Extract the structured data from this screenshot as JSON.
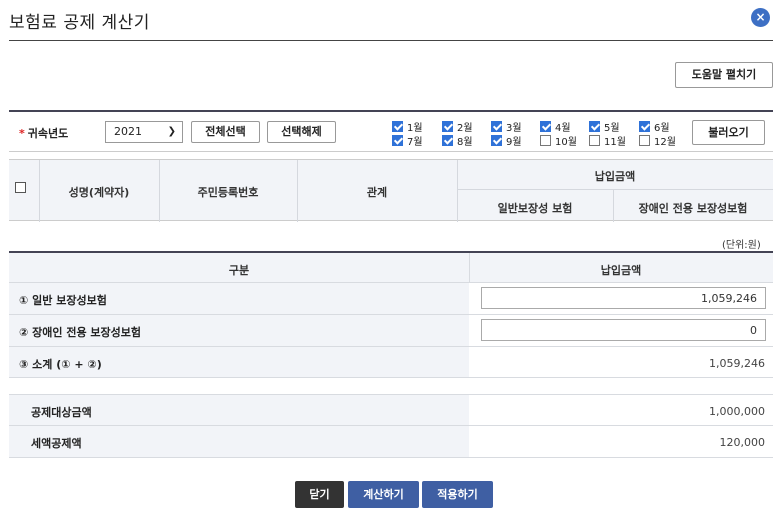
{
  "header": {
    "title": "보험료 공제 계산기",
    "close_icon": "×"
  },
  "toolbar": {
    "help_label": "도움말 펼치기"
  },
  "filter": {
    "year_label": "귀속년도",
    "year_value": "2021",
    "select_all_label": "전체선택",
    "deselect_label": "선택해제",
    "load_label": "불러오기",
    "months": [
      {
        "label": "1월",
        "checked": true
      },
      {
        "label": "2월",
        "checked": true
      },
      {
        "label": "3월",
        "checked": true
      },
      {
        "label": "4월",
        "checked": true
      },
      {
        "label": "5월",
        "checked": true
      },
      {
        "label": "6월",
        "checked": true
      },
      {
        "label": "7월",
        "checked": true
      },
      {
        "label": "8월",
        "checked": true
      },
      {
        "label": "9월",
        "checked": true
      },
      {
        "label": "10월",
        "checked": false
      },
      {
        "label": "11월",
        "checked": false
      },
      {
        "label": "12월",
        "checked": false
      }
    ]
  },
  "table": {
    "col_name": "성명(계약자)",
    "col_id": "주민등록번호",
    "col_relation": "관계",
    "col_paid": "납입금액",
    "col_general": "일반보장성 보험",
    "col_disabled": "장애인 전용 보장성보험"
  },
  "unit_label": "(단위:원)",
  "calc": {
    "header_category": "구분",
    "header_amount": "납입금액",
    "rows": [
      {
        "label": "① 일반 보장성보험",
        "value": "1,059,246"
      },
      {
        "label": "② 장애인 전용 보장성보험",
        "value": "0"
      },
      {
        "label": "③ 소계 (① + ②)",
        "value": "1,059,246"
      }
    ],
    "deductible_label": "공제대상금액",
    "deductible_value": "1,000,000",
    "tax_credit_label": "세액공제액",
    "tax_credit_value": "120,000"
  },
  "footer": {
    "close_label": "닫기",
    "calculate_label": "계산하기",
    "apply_label": "적용하기"
  },
  "colors": {
    "accent": "#3f5fa3",
    "close_circle": "#3d6fc4",
    "checkbox": "#2f72d8"
  }
}
